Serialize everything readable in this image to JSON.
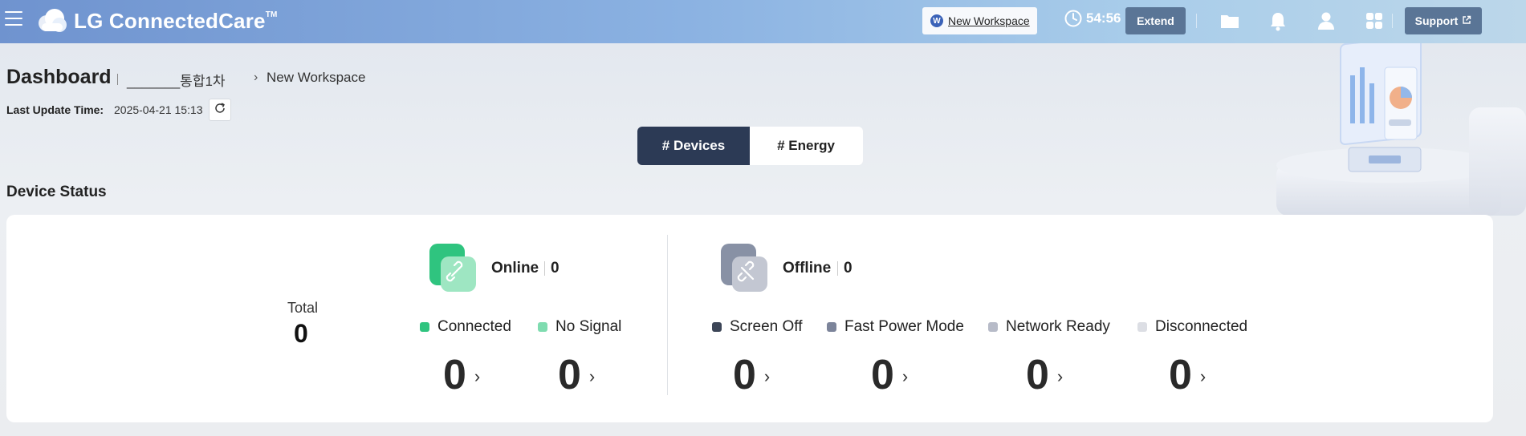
{
  "app": {
    "name": "LG ConnectedCare",
    "trademark": "TM"
  },
  "topbar": {
    "workspace_badge": "W",
    "workspace_label": "New Workspace",
    "timer": "54:56",
    "extend_label": "Extend",
    "support_label": "Support"
  },
  "header": {
    "title": "Dashboard",
    "breadcrumb": [
      "_______통합1차",
      "New Workspace"
    ],
    "last_update_label": "Last Update Time:",
    "last_update_value": "2025-04-21 15:13"
  },
  "tabs": [
    {
      "label": "# Devices",
      "active": true
    },
    {
      "label": "# Energy",
      "active": false
    }
  ],
  "device_status": {
    "section_title": "Device Status",
    "total_label": "Total",
    "total_value": "0",
    "online": {
      "label": "Online",
      "count": "0",
      "color": "#2fc47f",
      "items": [
        {
          "label": "Connected",
          "value": "0",
          "color": "#2fc47f"
        },
        {
          "label": "No Signal",
          "value": "0",
          "color": "#7fdcb0"
        }
      ]
    },
    "offline": {
      "label": "Offline",
      "count": "0",
      "color": "#8891a5",
      "items": [
        {
          "label": "Screen Off",
          "value": "0",
          "color": "#3c4557"
        },
        {
          "label": "Fast Power Mode",
          "value": "0",
          "color": "#7c849a"
        },
        {
          "label": "Network Ready",
          "value": "0",
          "color": "#b7bbc8"
        },
        {
          "label": "Disconnected",
          "value": "0",
          "color": "#dcdee4"
        }
      ]
    }
  },
  "icons": [
    "menu-icon",
    "cloud-logo-icon",
    "clock-icon",
    "folder-icon",
    "bell-icon",
    "user-icon",
    "apps-grid-icon",
    "external-link-icon",
    "refresh-icon",
    "link-icon",
    "unlink-icon",
    "chevron-right-icon"
  ]
}
